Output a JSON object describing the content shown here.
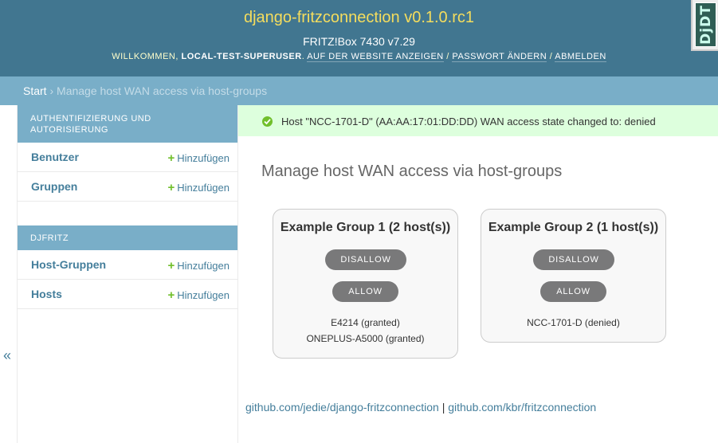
{
  "header": {
    "site_name": "django-fritzconnection v0.1.0.rc1",
    "subtitle": "FRITZ!Box 7430 v7.29",
    "welcome": "Willkommen,",
    "username": "local-test-superuser",
    "links": [
      "Auf der Website anzeigen",
      "Passwort ändern",
      "Abmelden"
    ],
    "separator": "/",
    "djdt_label": "DjDT"
  },
  "breadcrumbs": {
    "home": "Start",
    "separator": "›",
    "current": "Manage host WAN access via host-groups"
  },
  "sidebar": {
    "collapse_label": "«",
    "modules": [
      {
        "caption": "Authentifizierung und Autorisierung",
        "rows": [
          {
            "name": "Benutzer",
            "add": "Hinzufügen"
          },
          {
            "name": "Gruppen",
            "add": "Hinzufügen"
          }
        ]
      },
      {
        "caption": "Djfritz",
        "rows": [
          {
            "name": "Host-Gruppen",
            "add": "Hinzufügen"
          },
          {
            "name": "Hosts",
            "add": "Hinzufügen"
          }
        ]
      }
    ]
  },
  "message": "Host \"NCC-1701-D\" (AA:AA:17:01:DD:DD) WAN access state changed to: denied",
  "page_title": "Manage host WAN access via host-groups",
  "groups": [
    {
      "title": "Example Group 1 (2 host(s))",
      "disallow": "Disallow",
      "allow": "Allow",
      "hosts": [
        "E4214 (granted)",
        "ONEPLUS-A5000 (granted)"
      ]
    },
    {
      "title": "Example Group 2 (1 host(s))",
      "disallow": "Disallow",
      "allow": "Allow",
      "hosts": [
        "NCC-1701-D (denied)"
      ]
    }
  ],
  "footer": {
    "links": [
      "github.com/jedie/django-fritzconnection",
      "github.com/kbr/fritzconnection"
    ],
    "separator": "|"
  },
  "colors": {
    "header_bg": "#417690",
    "breadcrumb_bg": "#79aec8",
    "site_name": "#f5dd5d",
    "success_bg": "#dfd",
    "link": "#447e9b",
    "add_icon": "#70bf2b",
    "button": "#79797a"
  }
}
